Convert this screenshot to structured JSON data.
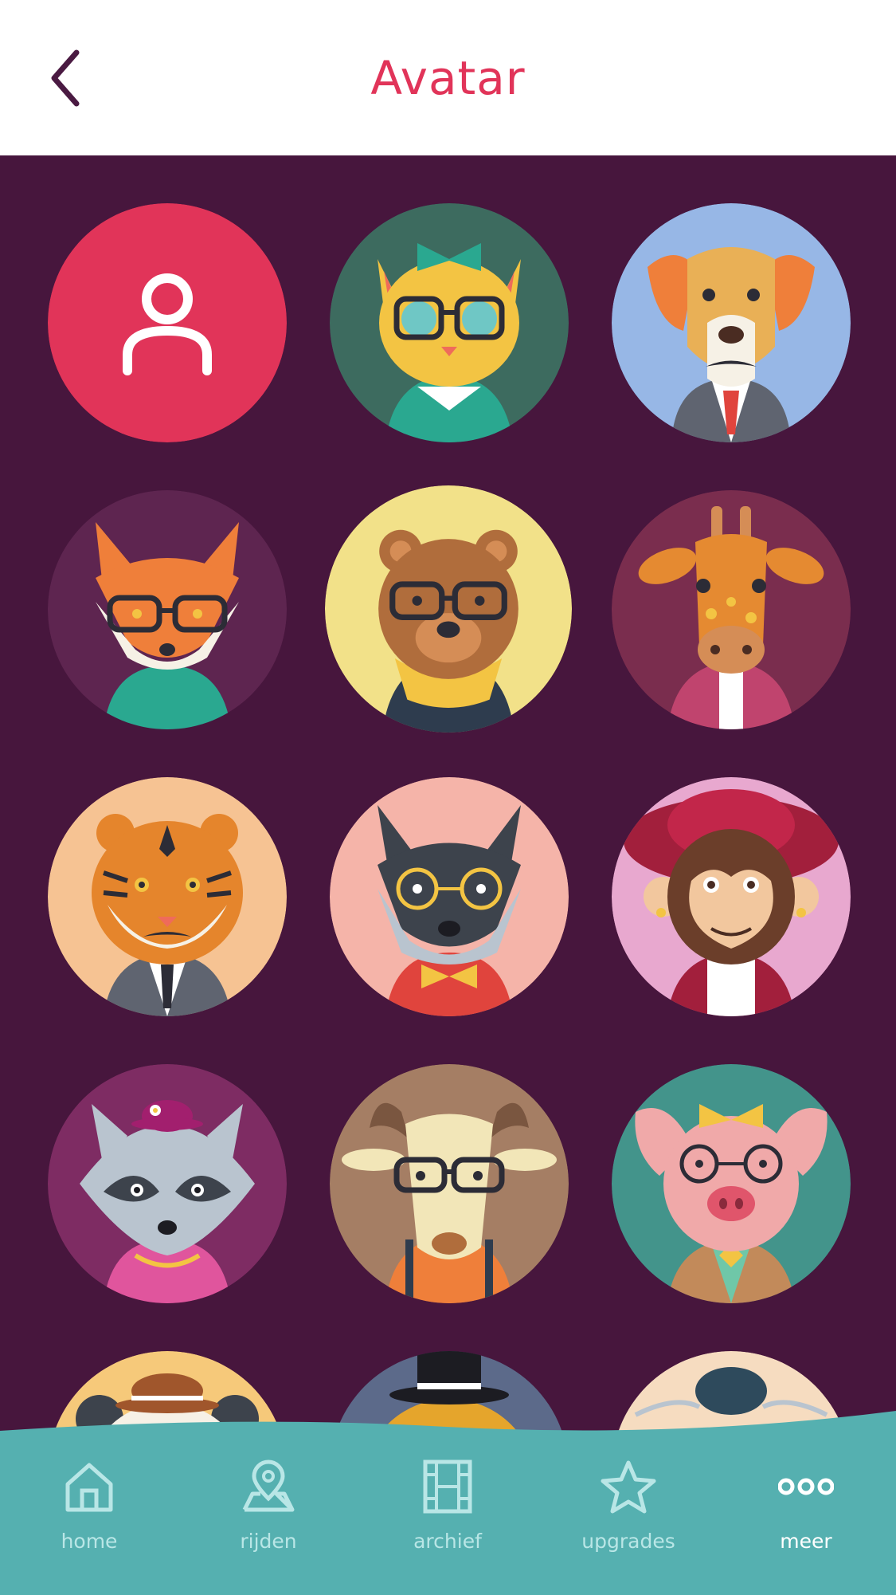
{
  "header": {
    "title": "Avatar"
  },
  "avatars": [
    {
      "id": "default-user",
      "bg": "#e13459"
    },
    {
      "id": "cat",
      "bg": "#3d6b5f"
    },
    {
      "id": "dog",
      "bg": "#97b7e6"
    },
    {
      "id": "fox",
      "bg": "#5e2550"
    },
    {
      "id": "bear",
      "bg": "#f2e189"
    },
    {
      "id": "giraffe",
      "bg": "#7a2d4e"
    },
    {
      "id": "tiger",
      "bg": "#f6c393"
    },
    {
      "id": "wolf",
      "bg": "#f5b4a9"
    },
    {
      "id": "monkey",
      "bg": "#e8a8cf"
    },
    {
      "id": "raccoon",
      "bg": "#7e2c63"
    },
    {
      "id": "goat",
      "bg": "#a57e64"
    },
    {
      "id": "pig",
      "bg": "#43948b"
    }
  ],
  "tabs": [
    {
      "label": "home",
      "icon": "home-icon"
    },
    {
      "label": "rijden",
      "icon": "map-pin-icon"
    },
    {
      "label": "archief",
      "icon": "film-icon"
    },
    {
      "label": "upgrades",
      "icon": "star-icon"
    },
    {
      "label": "meer",
      "icon": "more-icon",
      "active": true
    }
  ],
  "colors": {
    "accent": "#e13459",
    "background": "#47163d",
    "tabbar": "#55b0b0"
  }
}
